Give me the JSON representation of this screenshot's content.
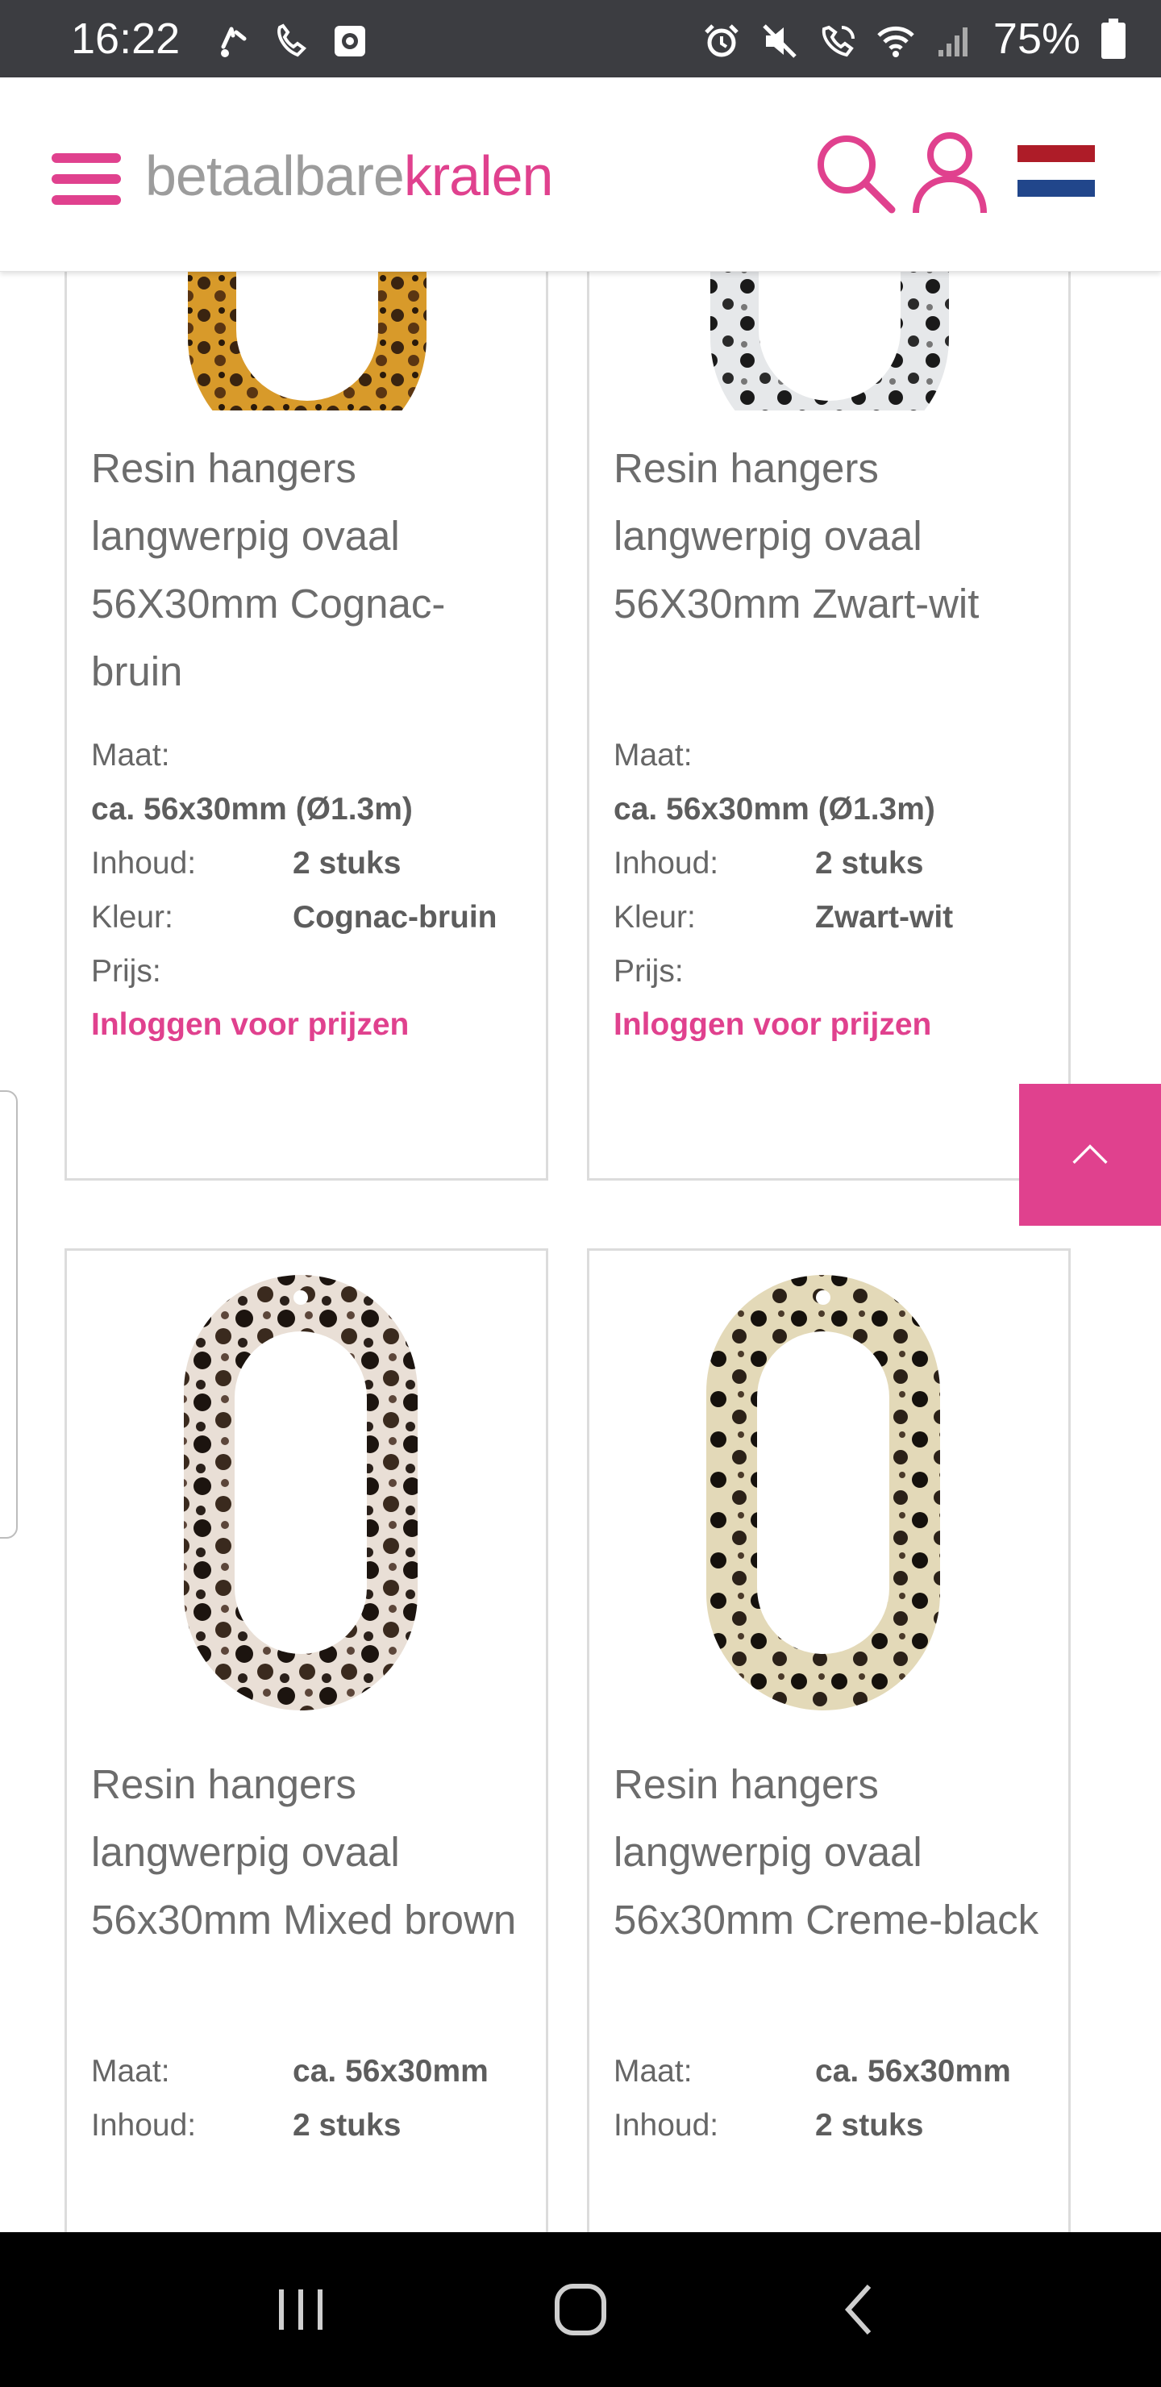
{
  "status_bar": {
    "time": "16:22",
    "battery": "75%",
    "icons": [
      "missed-call-icon",
      "voicemail-icon",
      "screen-recorder-icon",
      "alarm-icon",
      "mute-icon",
      "wifi-calling-icon",
      "wifi-icon",
      "signal-icon",
      "battery-icon"
    ]
  },
  "header": {
    "logo_part1": "betaalbare",
    "logo_part2": "kralen",
    "icons": [
      "menu-icon",
      "search-icon",
      "user-icon",
      "netherlands-flag-icon"
    ]
  },
  "colors": {
    "accent": "#e0418e",
    "status_bar": "#3c3d41",
    "nav_bar": "#000000",
    "flag_red": "#ae1c28",
    "flag_blue": "#21468b"
  },
  "products": [
    {
      "title": "Resin hangers langwerpig ovaal 56X30mm Cognac-bruin",
      "maat_label": "Maat:",
      "maat_value": "ca. 56x30mm (Ø1.3m)",
      "inhoud_label": "Inhoud:",
      "inhoud_value": "2 stuks",
      "kleur_label": "Kleur:",
      "kleur_value": "Cognac-bruin",
      "prijs_label": "Prijs:",
      "login_text": "Inloggen voor prijzen"
    },
    {
      "title": "Resin hangers langwerpig ovaal 56X30mm Zwart-wit",
      "maat_label": "Maat:",
      "maat_value": "ca. 56x30mm (Ø1.3m)",
      "inhoud_label": "Inhoud:",
      "inhoud_value": "2 stuks",
      "kleur_label": "Kleur:",
      "kleur_value": "Zwart-wit",
      "prijs_label": "Prijs:",
      "login_text": "Inloggen voor prijzen"
    },
    {
      "title": "Resin hangers langwerpig ovaal 56x30mm Mixed brown",
      "maat_label": "Maat:",
      "maat_value": "ca. 56x30mm",
      "inhoud_label": "Inhoud:",
      "inhoud_value": "2 stuks"
    },
    {
      "title": "Resin hangers langwerpig ovaal 56x30mm Creme-black",
      "maat_label": "Maat:",
      "maat_value": "ca. 56x30mm",
      "inhoud_label": "Inhoud:",
      "inhoud_value": "2 stuks"
    }
  ],
  "nav_bar": {
    "icons": [
      "recent-apps-icon",
      "home-icon",
      "back-icon"
    ]
  }
}
